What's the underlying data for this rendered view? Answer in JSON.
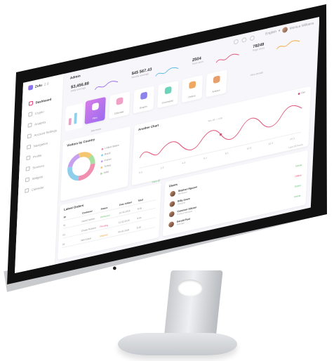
{
  "app": {
    "brand": "Zulu",
    "version": "2.0",
    "page_title": "Admin"
  },
  "topbar": {
    "language": "English",
    "user_name": "Monica Williams"
  },
  "sidebar": {
    "items": [
      {
        "label": "Dashboard",
        "active": true
      },
      {
        "label": "Crypto",
        "active": false
      },
      {
        "label": "Analysis",
        "active": false
      },
      {
        "label": "Account Settings",
        "active": false
      },
      {
        "label": "Navigation",
        "active": false
      },
      {
        "label": "Profile",
        "active": false
      },
      {
        "label": "Services",
        "active": false
      },
      {
        "label": "Widgets",
        "active": false
      },
      {
        "label": "Calendar",
        "active": false
      }
    ]
  },
  "stats": [
    {
      "value": "$3,456.88",
      "label": "Daily earnings",
      "color": "#9b6bf0"
    },
    {
      "value": "$45 567.43",
      "label": "Weekly earnings",
      "color": "#5bb8e6"
    },
    {
      "value": "2504",
      "label": "Total users",
      "color": "#e05577"
    },
    {
      "value": "78249",
      "label": "Page views",
      "color": "#f3a642"
    }
  ],
  "quick_links": [
    {
      "label": "Files",
      "icon": "folder-icon",
      "color": "#ffffff"
    },
    {
      "label": "Calendar",
      "icon": "calendar-icon",
      "color": "#f1a0c6"
    },
    {
      "label": "Graphs",
      "icon": "graph-icon",
      "color": "#8c84ec"
    },
    {
      "label": "Comments",
      "icon": "comment-icon",
      "color": "#6cd4b8"
    },
    {
      "label": "Orders",
      "icon": "cart-icon",
      "color": "#f0a760"
    },
    {
      "label": "Articles",
      "icon": "article-icon",
      "color": "#e5a06e"
    }
  ],
  "view_details": "View Details",
  "see_more": "See more",
  "visitors": {
    "title": "Visitors by Country",
    "countries": [
      {
        "name": "United States",
        "color": "#f08fb0"
      },
      {
        "name": "Brazil",
        "color": "#8ed0ec"
      },
      {
        "name": "France",
        "color": "#c7a0f0"
      },
      {
        "name": "Turkey",
        "color": "#f4c66f"
      },
      {
        "name": "India",
        "color": "#a7e0a0"
      }
    ]
  },
  "another_chart": {
    "title": "Another Chart",
    "legend": "Dec",
    "tooltip": "Nov 29 — 4.56",
    "x_labels": [
      "0.3",
      "2.3",
      "4.3",
      "6.1",
      "8.1",
      "10.3",
      "12.3",
      "14.3"
    ],
    "footer": "Last 24 hours"
  },
  "latest_orders": {
    "title": "Latest Orders",
    "columns": [
      "ID",
      "Customer",
      "Status",
      "Date Added",
      "Total"
    ],
    "rows": [
      {
        "id": "01",
        "customer": "David Stokes",
        "status": "Delivered",
        "date": "12.02.2016",
        "total": "$ 45"
      },
      {
        "id": "02",
        "customer": "Chase Roberts",
        "status": "Pending",
        "date": "11.02.2016",
        "total": "$ 84"
      },
      {
        "id": "03",
        "customer": "Nell Edwin",
        "status": "Shipped",
        "date": "09.02.2016",
        "total": "$ 26"
      }
    ]
  },
  "users": {
    "title": "Users",
    "people": [
      {
        "name": "Stephan Nguyen",
        "role": "Developer",
        "status": "Online"
      },
      {
        "name": "Billy Grant",
        "role": "Designer",
        "status": "Offline"
      },
      {
        "name": "Cameron Gibson",
        "role": "Product Manager",
        "status": "Online"
      },
      {
        "name": "Gerald Paul",
        "role": "Manager",
        "status": "Online"
      }
    ],
    "view_all": "View all"
  }
}
